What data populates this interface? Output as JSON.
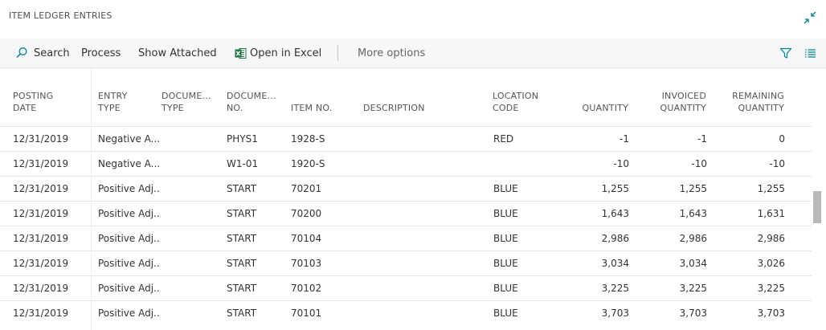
{
  "page": {
    "title": "ITEM LEDGER ENTRIES"
  },
  "toolbar": {
    "search_label": "Search",
    "process_label": "Process",
    "show_attached_label": "Show Attached",
    "open_excel_label": "Open in Excel",
    "more_options_label": "More options"
  },
  "columns": {
    "posting_date": [
      "POSTING",
      "DATE"
    ],
    "entry_type": [
      "ENTRY",
      "TYPE"
    ],
    "document_type": [
      "DOCUME...",
      "TYPE"
    ],
    "document_no": [
      "DOCUME...",
      "NO."
    ],
    "item_no": "ITEM NO.",
    "description": "DESCRIPTION",
    "location_code": [
      "LOCATION",
      "CODE"
    ],
    "quantity": "QUANTITY",
    "invoiced_quantity": [
      "INVOICED",
      "QUANTITY"
    ],
    "remaining_quantity": [
      "REMAINING",
      "QUANTITY"
    ]
  },
  "rows": [
    {
      "posting_date": "12/31/2019",
      "entry_type": "Negative A...",
      "document_type": "",
      "document_no": "PHYS1",
      "item_no": "1928-S",
      "description": "",
      "location_code": "RED",
      "quantity": "-1",
      "invoiced_quantity": "-1",
      "remaining_quantity": "0"
    },
    {
      "posting_date": "12/31/2019",
      "entry_type": "Negative A...",
      "document_type": "",
      "document_no": "W1-01",
      "item_no": "1920-S",
      "description": "",
      "location_code": "",
      "quantity": "-10",
      "invoiced_quantity": "-10",
      "remaining_quantity": "-10"
    },
    {
      "posting_date": "12/31/2019",
      "entry_type": "Positive Adj...",
      "document_type": "",
      "document_no": "START",
      "item_no": "70201",
      "description": "",
      "location_code": "BLUE",
      "quantity": "1,255",
      "invoiced_quantity": "1,255",
      "remaining_quantity": "1,255"
    },
    {
      "posting_date": "12/31/2019",
      "entry_type": "Positive Adj...",
      "document_type": "",
      "document_no": "START",
      "item_no": "70200",
      "description": "",
      "location_code": "BLUE",
      "quantity": "1,643",
      "invoiced_quantity": "1,643",
      "remaining_quantity": "1,631"
    },
    {
      "posting_date": "12/31/2019",
      "entry_type": "Positive Adj...",
      "document_type": "",
      "document_no": "START",
      "item_no": "70104",
      "description": "",
      "location_code": "BLUE",
      "quantity": "2,986",
      "invoiced_quantity": "2,986",
      "remaining_quantity": "2,986"
    },
    {
      "posting_date": "12/31/2019",
      "entry_type": "Positive Adj...",
      "document_type": "",
      "document_no": "START",
      "item_no": "70103",
      "description": "",
      "location_code": "BLUE",
      "quantity": "3,034",
      "invoiced_quantity": "3,034",
      "remaining_quantity": "3,026"
    },
    {
      "posting_date": "12/31/2019",
      "entry_type": "Positive Adj...",
      "document_type": "",
      "document_no": "START",
      "item_no": "70102",
      "description": "",
      "location_code": "BLUE",
      "quantity": "3,225",
      "invoiced_quantity": "3,225",
      "remaining_quantity": "3,225"
    },
    {
      "posting_date": "12/31/2019",
      "entry_type": "Positive Adj...",
      "document_type": "",
      "document_no": "START",
      "item_no": "70101",
      "description": "",
      "location_code": "BLUE",
      "quantity": "3,703",
      "invoiced_quantity": "3,703",
      "remaining_quantity": "3,703"
    }
  ],
  "colors": {
    "accent": "#00838f",
    "excel": "#217346"
  },
  "icons": [
    "collapse-icon",
    "search-icon",
    "excel-icon",
    "filter-icon",
    "list-icon"
  ]
}
